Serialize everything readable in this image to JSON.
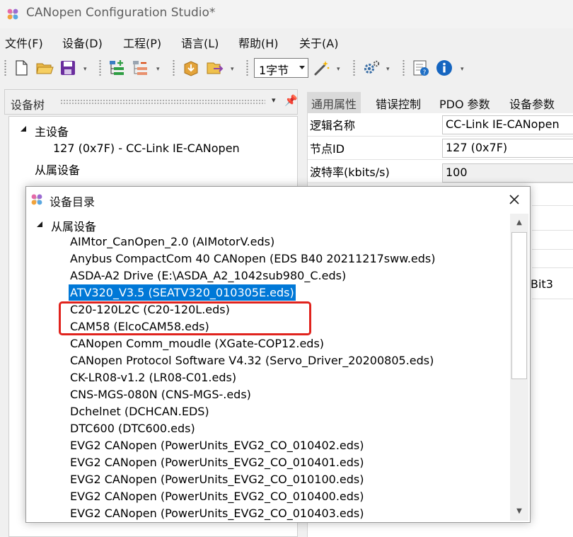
{
  "window": {
    "title": "CANopen Configuration Studio*"
  },
  "menu": [
    "文件(F)",
    "设备(D)",
    "工程(P)",
    "语言(L)",
    "帮助(H)",
    "关于(A)"
  ],
  "toolbar": {
    "byte_combo_value": "1字节",
    "icons": [
      "new-file-icon",
      "open-folder-icon",
      "save-icon",
      "add-device-icon",
      "remove-device-icon",
      "import-icon",
      "export-icon",
      "wand-icon",
      "settings-icon",
      "help-icon",
      "info-icon"
    ]
  },
  "left_panel": {
    "title": "设备树",
    "master_label": "主设备",
    "master_item": "127 (0x7F)  -  CC-Link IE-CANopen",
    "slave_label": "从属设备"
  },
  "right_panel": {
    "tabs": [
      "通用属性",
      "错误控制",
      "PDO 参数",
      "设备参数"
    ],
    "active_tab": 0,
    "props": [
      {
        "label": "逻辑名称",
        "value": "CC-Link IE-CANopen"
      },
      {
        "label": "节点ID",
        "value": "127 (0x7F)"
      },
      {
        "label": "波特率(kbits/s)",
        "value": "100"
      }
    ],
    "peek_text": "Bit3"
  },
  "dialog": {
    "title": "设备目录",
    "root_label": "从属设备",
    "selected_index": 3,
    "items": [
      "AIMtor_CanOpen_2.0 (AIMotorV.eds)",
      "Anybus CompactCom 40 CANopen (EDS B40 20211217sww.eds)",
      "ASDA-A2 Drive (E:\\ASDA_A2_1042sub980_C.eds)",
      "ATV320_V3.5 (SEATV320_010305E.eds)",
      "C20-120L2C (C20-120L.eds)",
      "CAM58 (ElcoCAM58.eds)",
      "CANopen Comm_moudle (XGate-COP12.eds)",
      "CANopen Protocol Software V4.32 (Servo_Driver_20200805.eds)",
      "CK-LR08-v1.2 (LR08-C01.eds)",
      "CNS-MGS-080N (CNS-MGS-.eds)",
      "Dchelnet (DCHCAN.EDS)",
      "DTC600 (DTC600.eds)",
      "EVG2 CANopen (PowerUnits_EVG2_CO_010402.eds)",
      "EVG2 CANopen (PowerUnits_EVG2_CO_010401.eds)",
      "EVG2 CANopen (PowerUnits_EVG2_CO_010100.eds)",
      "EVG2 CANopen (PowerUnits_EVG2_CO_010400.eds)",
      "EVG2 CANopen (PowerUnits_EVG2_CO_010403.eds)"
    ]
  },
  "colors": {
    "selection": "#0078d7",
    "highlight_box": "#e0231d",
    "save_icon": "#6b2e9e",
    "info_icon": "#1565c0"
  }
}
